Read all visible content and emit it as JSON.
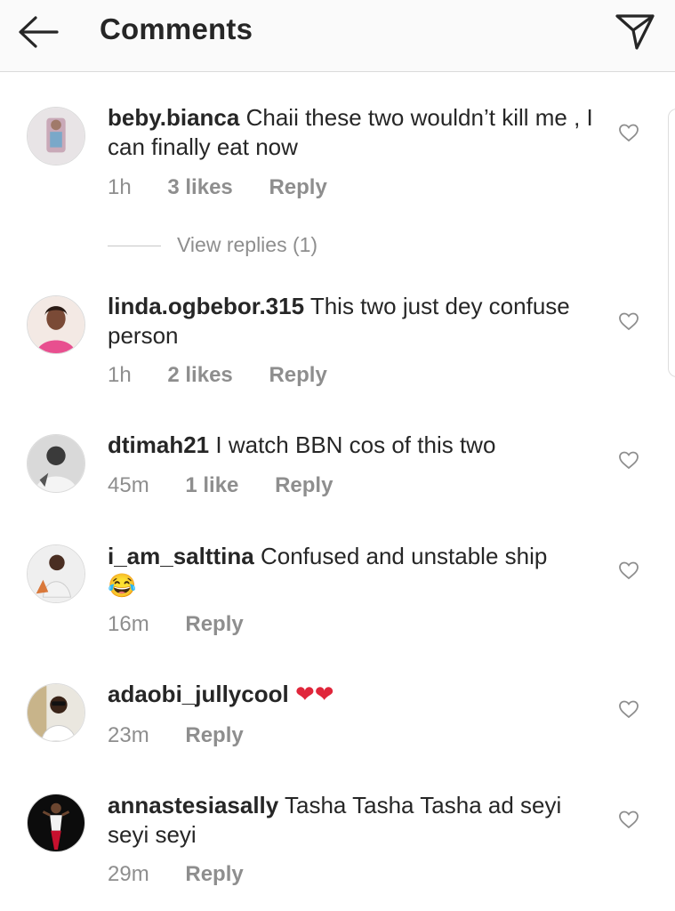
{
  "header": {
    "title": "Comments",
    "back_icon": "arrow-left-icon",
    "send_icon": "paper-plane-icon"
  },
  "comments": [
    {
      "username": "beby.bianca",
      "text": "Chaii these two wouldn’t kill me , I can finally eat now",
      "time": "1h",
      "likes": "3 likes",
      "reply": "Reply",
      "view_replies": "View replies (1)"
    },
    {
      "username": "linda.ogbebor.315",
      "text": "This two just dey confuse person",
      "time": "1h",
      "likes": "2 likes",
      "reply": "Reply"
    },
    {
      "username": "dtimah21",
      "text": "I watch BBN cos of this two",
      "time": "45m",
      "likes": "1 like",
      "reply": "Reply"
    },
    {
      "username": "i_am_salttina",
      "text": "Confused and unstable ship",
      "emoji": "😂",
      "time": "16m",
      "reply": "Reply"
    },
    {
      "username": "adaobi_jullycool",
      "emoji": "❤❤",
      "time": "23m",
      "reply": "Reply"
    },
    {
      "username": "annastesiasally",
      "text": "Tasha Tasha Tasha ad seyi seyi seyi",
      "time": "29m",
      "reply": "Reply"
    }
  ],
  "colors": {
    "text": "#262626",
    "muted": "#8e8e8e",
    "heart_red": "#e0263b"
  }
}
